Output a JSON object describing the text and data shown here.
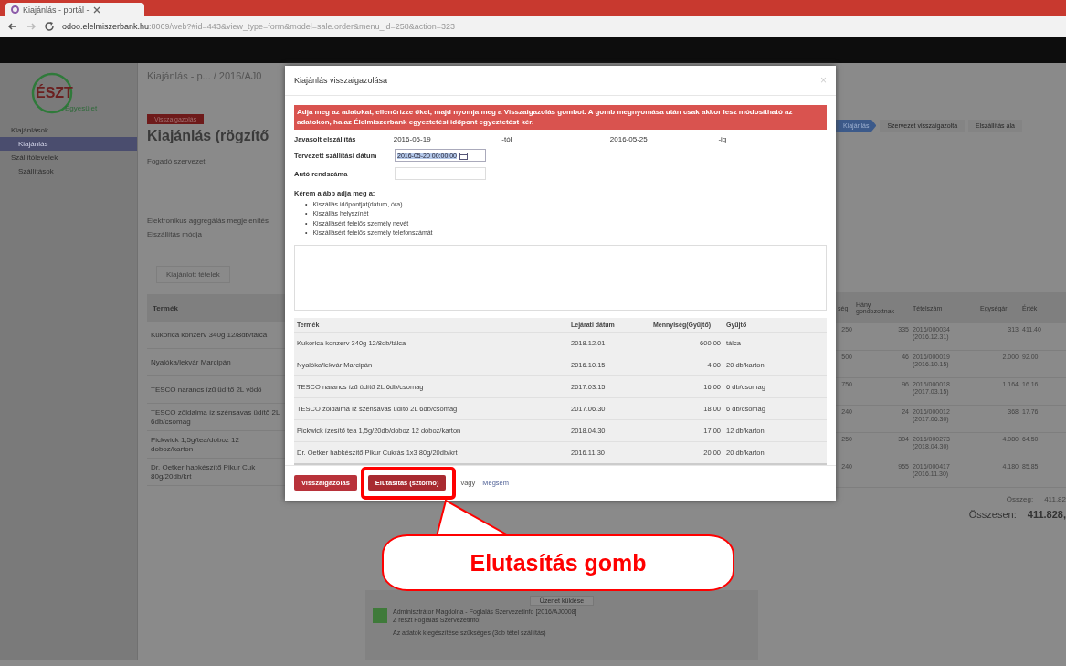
{
  "browser": {
    "tab_title": "Kiajánlás - portál -",
    "url_host": "odoo.elelmiszerbank.hu",
    "url_rest": ":8069/web?#id=443&view_type=form&model=sale.order&menu_id=258&action=323"
  },
  "logo": {
    "letters": "ÉSZT",
    "subtitle": "Egyesület"
  },
  "sidebar": [
    {
      "title": "Kiajánlások",
      "items": [
        {
          "label": "Kiajánlás",
          "selected": true
        }
      ]
    },
    {
      "title": "Szállítólevelek",
      "items": [
        {
          "label": "Szállítások",
          "selected": false
        }
      ]
    }
  ],
  "page": {
    "breadcrumb": "Kiajánlás - p... / 2016/AJ0",
    "action_button": "Visszaigazolás",
    "title": "Kiajánlás (rögzítő",
    "field_labels": [
      "Fogadó szervezet",
      "Elektronikus aggregálás megjelenítés",
      "Elszállítás módja"
    ],
    "notebook_tab": "Kiajánlott tételek"
  },
  "steps": [
    {
      "label": "Kiajánlás",
      "selected": true
    },
    {
      "label": "Szervezet visszaigazolta",
      "selected": false
    },
    {
      "label": "Elszállítás ala",
      "selected": false
    }
  ],
  "items_table": {
    "columns": [
      "Termék",
      "ség",
      "Hány gondozottnak",
      "Tételszám",
      "Egységár",
      "Érték"
    ],
    "rows": [
      {
        "product": "Kukorica konzerv 340g 12/8db/tálca",
        "column_2": "250",
        "recipients": "335",
        "lot": "2016/000034 (2016.12.31)",
        "unit_price": "313",
        "value": "411.40"
      },
      {
        "product": "Nyalóka/lekvár Marcipán",
        "column_2": "500",
        "recipients": "46",
        "lot": "2016/000019 (2016.10.15)",
        "unit_price": "2.000",
        "value": "92.00"
      },
      {
        "product": "TESCO narancs ízű üdítő 2L vödö",
        "column_2": "750",
        "recipients": "96",
        "lot": "2016/000018 (2017.03.15)",
        "unit_price": "1.164",
        "value": "16.16"
      },
      {
        "product": "TESCO zöldalma íz szénsavas üdítő 2L 6db/csomag",
        "column_2": "240",
        "recipients": "24",
        "lot": "2016/000012 (2017.06.30)",
        "unit_price": "368",
        "value": "17.76"
      },
      {
        "product": "Pickwick 1,5g/tea/doboz 12 doboz/karton",
        "column_2": "250",
        "recipients": "304",
        "lot": "2016/000273 (2018.04.30)",
        "unit_price": "4.080",
        "value": "64.50"
      },
      {
        "product": "Dr. Oetker habkészítő Pikur Cuk 80g/20db/krt",
        "column_2": "240",
        "recipients": "955",
        "lot": "2016/000417 (2016.11.30)",
        "unit_price": "4.180",
        "value": "85.85"
      }
    ]
  },
  "totals": [
    {
      "label": "Összeg:",
      "value": "411.82",
      "kind": "subtotal"
    },
    {
      "label": "Összesen:",
      "value": "411.828,",
      "kind": "total"
    }
  ],
  "chatter": {
    "send_button": "Üzenet küldése",
    "author": "Adminisztrátor Magdolna - Foglalás Szervezetinfo [2016/AJ0008]",
    "subject": "Z részt Foglalás Szervezetinfo!",
    "body": "Az adatok kiegészítése szükséges (3db tétel szállítás)"
  },
  "modal": {
    "title": "Kiajánlás visszaigazolása",
    "close": "×",
    "alert": "Adja meg az adatokat, ellenőrizze őket, majd nyomja meg a Visszaigazolás gombot. A gomb megnyomása után csak akkor lesz módosítható az adatokon, ha az Élelmiszerbank egyeztetési időpont egyeztetést kér.",
    "suggested": {
      "label": "Javasolt elszállítás",
      "from": "2016-05-19",
      "from_suffix": "-tól",
      "to": "2016-05-25",
      "to_suffix": "-ig"
    },
    "planned_date": {
      "label": "Tervezett szállítási dátum",
      "value": "2016-05-20 00:00:00"
    },
    "plate": {
      "label": "Autó rendszáma"
    },
    "instructions": "Kérem alább adja meg a:",
    "bullet_mark": "•",
    "bullets": [
      "Kiszállás időpontját(dátum, óra)",
      "Kiszállás helyszínét",
      "Kiszállásért felelős személy nevét",
      "Kiszállásért felelős személy telefonszámát"
    ],
    "table": {
      "columns": [
        "Termék",
        "Lejárati dátum",
        "Mennyiség(Gyűjtő)",
        "Gyűjtő"
      ],
      "rows": [
        [
          "Kukorica konzerv 340g 12/8db/tálca",
          "2018.12.01",
          "600,00",
          "tálca"
        ],
        [
          "Nyalóka/lekvár Marcipán",
          "2016.10.15",
          "4,00",
          "20 db/karton"
        ],
        [
          "TESCO narancs ízű üdítő 2L 6db/csomag",
          "2017.03.15",
          "16,00",
          "6 db/csomag"
        ],
        [
          "TESCO zöldalma íz szénsavas üdítő 2L 6db/csomag",
          "2017.06.30",
          "18,00",
          "6 db/csomag"
        ],
        [
          "Pickwick ízesítő tea 1,5g/20db/doboz 12 doboz/karton",
          "2018.04.30",
          "17,00",
          "12 db/karton"
        ],
        [
          "Dr. Oetker habkészítő Pikur Cukrás 1x3 80g/20db/krt",
          "2016.11.30",
          "20,00",
          "20 db/karton"
        ]
      ]
    },
    "buttons": [
      {
        "label": "Visszaigazolás",
        "kind": "confirm"
      },
      {
        "label": "Elutasítás (sztornó)",
        "kind": "reject"
      }
    ],
    "or_text": "vagy",
    "cancel": "Mégsem"
  },
  "annotation": {
    "text": "Elutasítás gomb"
  }
}
